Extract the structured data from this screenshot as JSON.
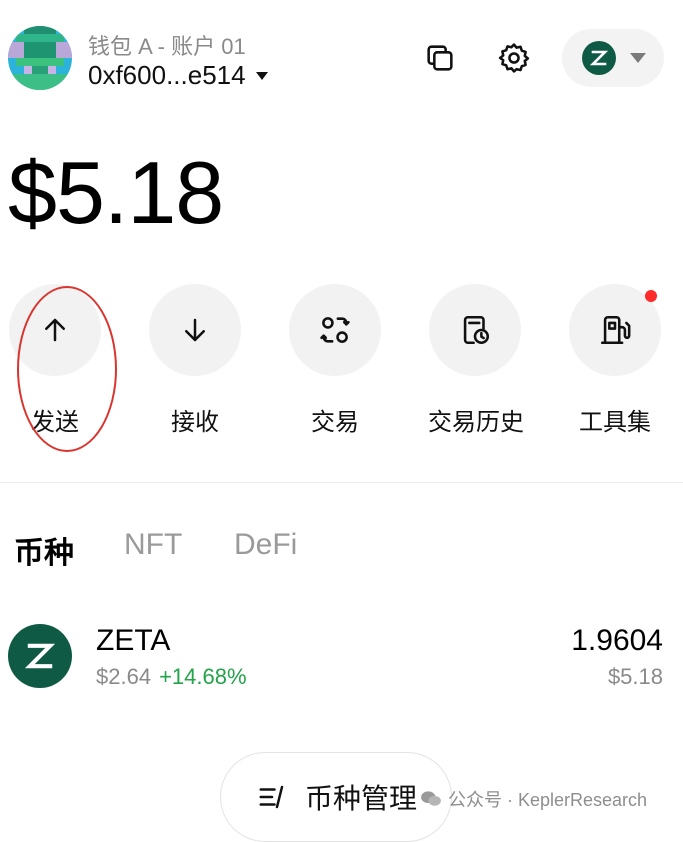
{
  "header": {
    "wallet_name": "钱包 A - 账户 01",
    "address": "0xf600...e514"
  },
  "balance": "$5.18",
  "actions": [
    {
      "label": "发送",
      "icon": "arrow-up-icon"
    },
    {
      "label": "接收",
      "icon": "arrow-down-icon"
    },
    {
      "label": "交易",
      "icon": "swap-icon"
    },
    {
      "label": "交易历史",
      "icon": "history-icon"
    },
    {
      "label": "工具集",
      "icon": "fuel-icon"
    }
  ],
  "tabs": [
    "币种",
    "NFT",
    "DeFi"
  ],
  "tokens": [
    {
      "symbol": "ZETA",
      "price": "$2.64",
      "change": "+14.68%",
      "amount": "1.9604",
      "value": "$5.18"
    }
  ],
  "manage_label": "币种管理",
  "watermark": "公众号 · KeplerResearch",
  "colors": {
    "brand": "#0f5a44",
    "positive": "#24a34a",
    "annotation": "#d9352e",
    "notification": "#ff2a2a"
  }
}
